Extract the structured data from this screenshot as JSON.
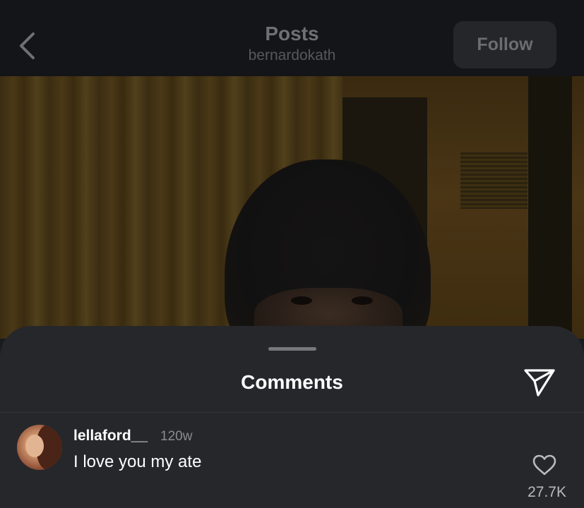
{
  "header": {
    "back_icon": "chevron-left-icon",
    "title": "Posts",
    "subtitle": "bernardokath",
    "follow_label": "Follow"
  },
  "post": {
    "image": "photo-of-person-with-dark-hair-in-dim-room"
  },
  "comments_sheet": {
    "title": "Comments",
    "share_icon": "send-icon",
    "comments": [
      {
        "username": "lellaford__",
        "time": "120w",
        "text": "I love you my ate",
        "like_icon": "heart-icon",
        "like_count": "27.7K"
      }
    ]
  },
  "colors": {
    "background": "#1a1b1f",
    "header_bg": "#141518",
    "sheet_bg": "#26272b",
    "text_primary": "#ffffff",
    "text_secondary": "#8a8c91"
  }
}
